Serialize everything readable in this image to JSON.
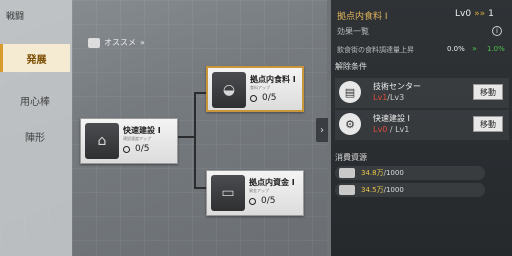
{
  "nav": {
    "title": "戦闘",
    "items": [
      {
        "label": "発展",
        "active": true
      },
      {
        "label": "用心棒",
        "active": false
      },
      {
        "label": "陣形",
        "active": false
      }
    ]
  },
  "tree": {
    "recommend_label": "オススメ",
    "recommend_arrows": "»",
    "nodes": [
      {
        "name": "快速建設 I",
        "progress": "0/5",
        "sub": "建設速度アップ"
      },
      {
        "name": "拠点内食料 I",
        "progress": "0/5",
        "sub": "食料アップ"
      },
      {
        "name": "拠点内資金 I",
        "progress": "0/5",
        "sub": "資金アップ"
      }
    ]
  },
  "panel": {
    "collapse_arrow": "›",
    "title": "拠点内食料 I",
    "level_current": "Lv0",
    "level_arrows": "»»",
    "level_next": "1",
    "effect_label": "効果一覧",
    "info_icon": "i",
    "stat_label": "飲食街の食料調達量上昇",
    "stat_from": "0.0%",
    "stat_arrow": "»",
    "stat_to": "1.0%",
    "requirements_title": "解除条件",
    "requirements": [
      {
        "name": "技術センター",
        "current": "Lv1",
        "required": "/Lv3",
        "button": "移動",
        "icon": "tech-center-icon"
      },
      {
        "name": "快速建設 I",
        "current": "Lv0",
        "required": " / Lv1",
        "button": "移動",
        "icon": "fast-build-icon"
      }
    ],
    "resources_title": "消費資源",
    "resources": [
      {
        "have": "34.8万",
        "need": "/1000",
        "icon": "food-icon"
      },
      {
        "have": "34.5万",
        "need": "/1000",
        "icon": "money-icon"
      }
    ]
  }
}
